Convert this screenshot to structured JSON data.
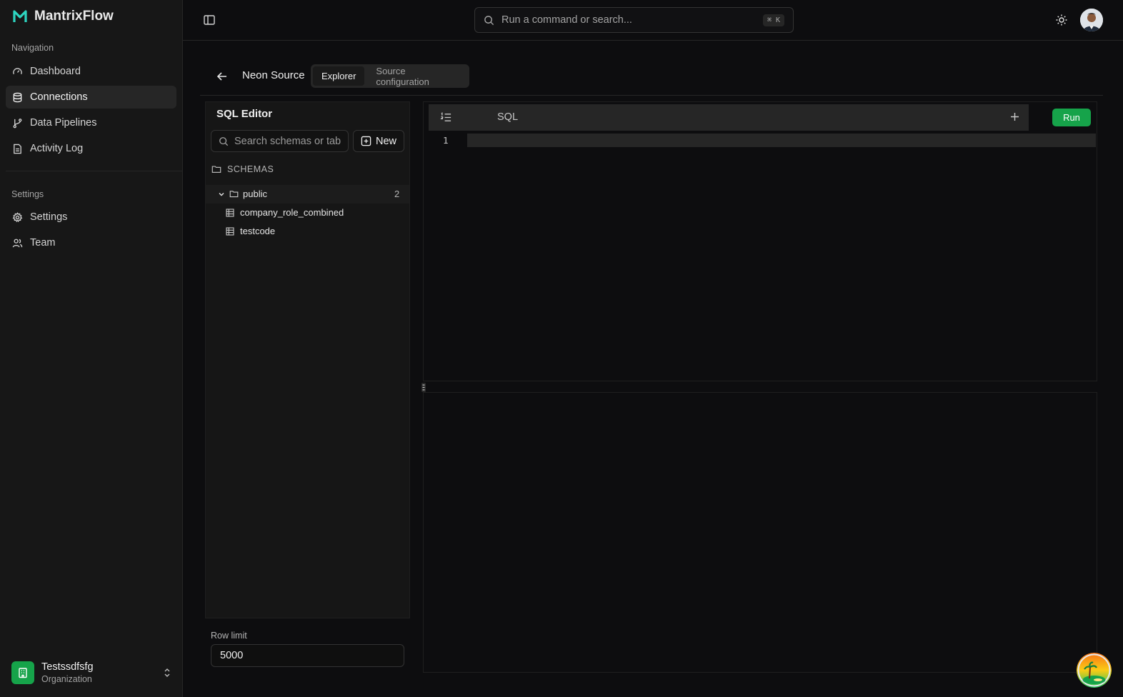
{
  "app": {
    "name": "MantrixFlow"
  },
  "sidebar": {
    "nav_section": "Navigation",
    "nav_items": [
      {
        "label": "Dashboard",
        "icon": "gauge-icon",
        "active": false
      },
      {
        "label": "Connections",
        "icon": "database-icon",
        "active": true
      },
      {
        "label": "Data Pipelines",
        "icon": "git-branch-icon",
        "active": false
      },
      {
        "label": "Activity Log",
        "icon": "file-text-icon",
        "active": false
      }
    ],
    "settings_section": "Settings",
    "settings_items": [
      {
        "label": "Settings",
        "icon": "gear-icon"
      },
      {
        "label": "Team",
        "icon": "users-icon"
      }
    ],
    "org": {
      "name": "Testssdfsfg",
      "subtitle": "Organization"
    }
  },
  "topbar": {
    "search_placeholder": "Run a command or search...",
    "shortcut": "⌘ K"
  },
  "header": {
    "title": "Neon Source",
    "tabs": [
      {
        "label": "Explorer",
        "active": true
      },
      {
        "label": "Source configuration",
        "active": false
      }
    ]
  },
  "explorer": {
    "title": "SQL Editor",
    "search_placeholder": "Search schemas or tables",
    "new_label": "New",
    "schemas_label": "SCHEMAS",
    "schema": {
      "name": "public",
      "count": "2"
    },
    "tables": [
      "company_role_combined",
      "testcode"
    ],
    "row_limit_label": "Row limit",
    "row_limit_value": "5000"
  },
  "editor": {
    "tab_label": "SQL",
    "run_label": "Run",
    "line_number": "1"
  },
  "colors": {
    "accent": "#16a34a",
    "background": "#0d0d0f",
    "sidebar": "#171717"
  }
}
